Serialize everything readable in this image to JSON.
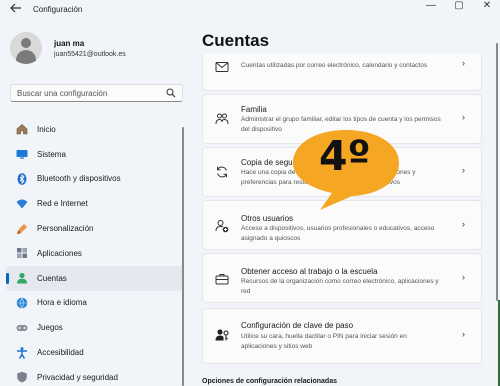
{
  "window": {
    "title": "Configuración",
    "back_icon": "arrow-left-icon",
    "min_label": "—",
    "max_label": "▢",
    "close_label": "✕"
  },
  "profile": {
    "name": "juan ma",
    "email": "juan55421@outlook.es"
  },
  "search": {
    "placeholder": "Buscar una configuración",
    "icon": "search-icon"
  },
  "sidebar": {
    "items": [
      {
        "label": "Inicio",
        "icon": "home-icon",
        "active": false
      },
      {
        "label": "Sistema",
        "icon": "monitor-icon",
        "active": false
      },
      {
        "label": "Bluetooth y dispositivos",
        "icon": "bluetooth-icon",
        "active": false
      },
      {
        "label": "Red e Internet",
        "icon": "wifi-icon",
        "active": false
      },
      {
        "label": "Personalización",
        "icon": "brush-icon",
        "active": false
      },
      {
        "label": "Aplicaciones",
        "icon": "apps-icon",
        "active": false
      },
      {
        "label": "Cuentas",
        "icon": "person-icon",
        "active": true
      },
      {
        "label": "Hora e idioma",
        "icon": "globe-clock-icon",
        "active": false
      },
      {
        "label": "Juegos",
        "icon": "gamepad-icon",
        "active": false
      },
      {
        "label": "Accesibilidad",
        "icon": "accessibility-icon",
        "active": false
      },
      {
        "label": "Privacidad y seguridad",
        "icon": "shield-icon",
        "active": false
      }
    ]
  },
  "main": {
    "title": "Cuentas",
    "cards": [
      {
        "title": "",
        "desc": "Cuentas utilizadas por correo electrónico, calendario y contactos",
        "icon": "mail-icon"
      },
      {
        "title": "Familia",
        "desc": "Administrar el grupo familiar, editar los tipos de cuenta y los permisos del dispositivo",
        "icon": "family-icon"
      },
      {
        "title": "Copia de seguridad de Windows",
        "desc": "Hace una copia de seguridad de tus archivos, aplicaciones y preferencias para restaurarlas en todos los dispositivos",
        "icon": "sync-icon"
      },
      {
        "title": "Otros usuarios",
        "desc": "Acceso a dispositivos, usuarios profesionales o educativos, acceso asignado a quioscos",
        "icon": "add-user-icon"
      },
      {
        "title": "Obtener acceso al trabajo o la escuela",
        "desc": "Recursos de la organización como correo electrónico, aplicaciones y red",
        "icon": "briefcase-icon"
      },
      {
        "title": "Configuración de clave de paso",
        "desc": "Utilice su cara, huella dactilar o PIN para iniciar sesión en aplicaciones y sitios web",
        "icon": "passkey-icon"
      }
    ],
    "chevron": "›",
    "related_title": "Opciones de configuración relacionadas"
  },
  "annotation": {
    "text": "4º",
    "color": "#f5a623"
  },
  "colors": {
    "accent": "#0067c0",
    "background": "#f1f4f9",
    "card": "#fbfbfb"
  }
}
